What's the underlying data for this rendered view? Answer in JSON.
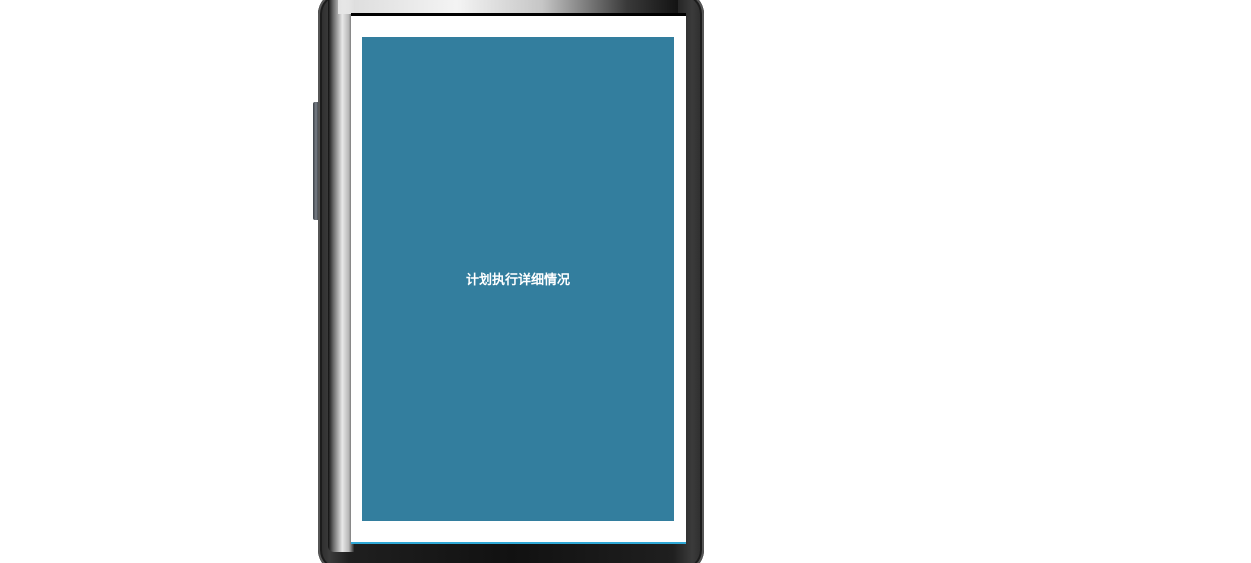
{
  "app": {
    "panel_title": "计划执行详细情况"
  },
  "colors": {
    "panel_background": "#337e9e",
    "panel_text": "#ffffff",
    "screen_background": "#ffffff",
    "screen_bottom_accent": "#2fa8d6",
    "device_frame": "#111111"
  }
}
